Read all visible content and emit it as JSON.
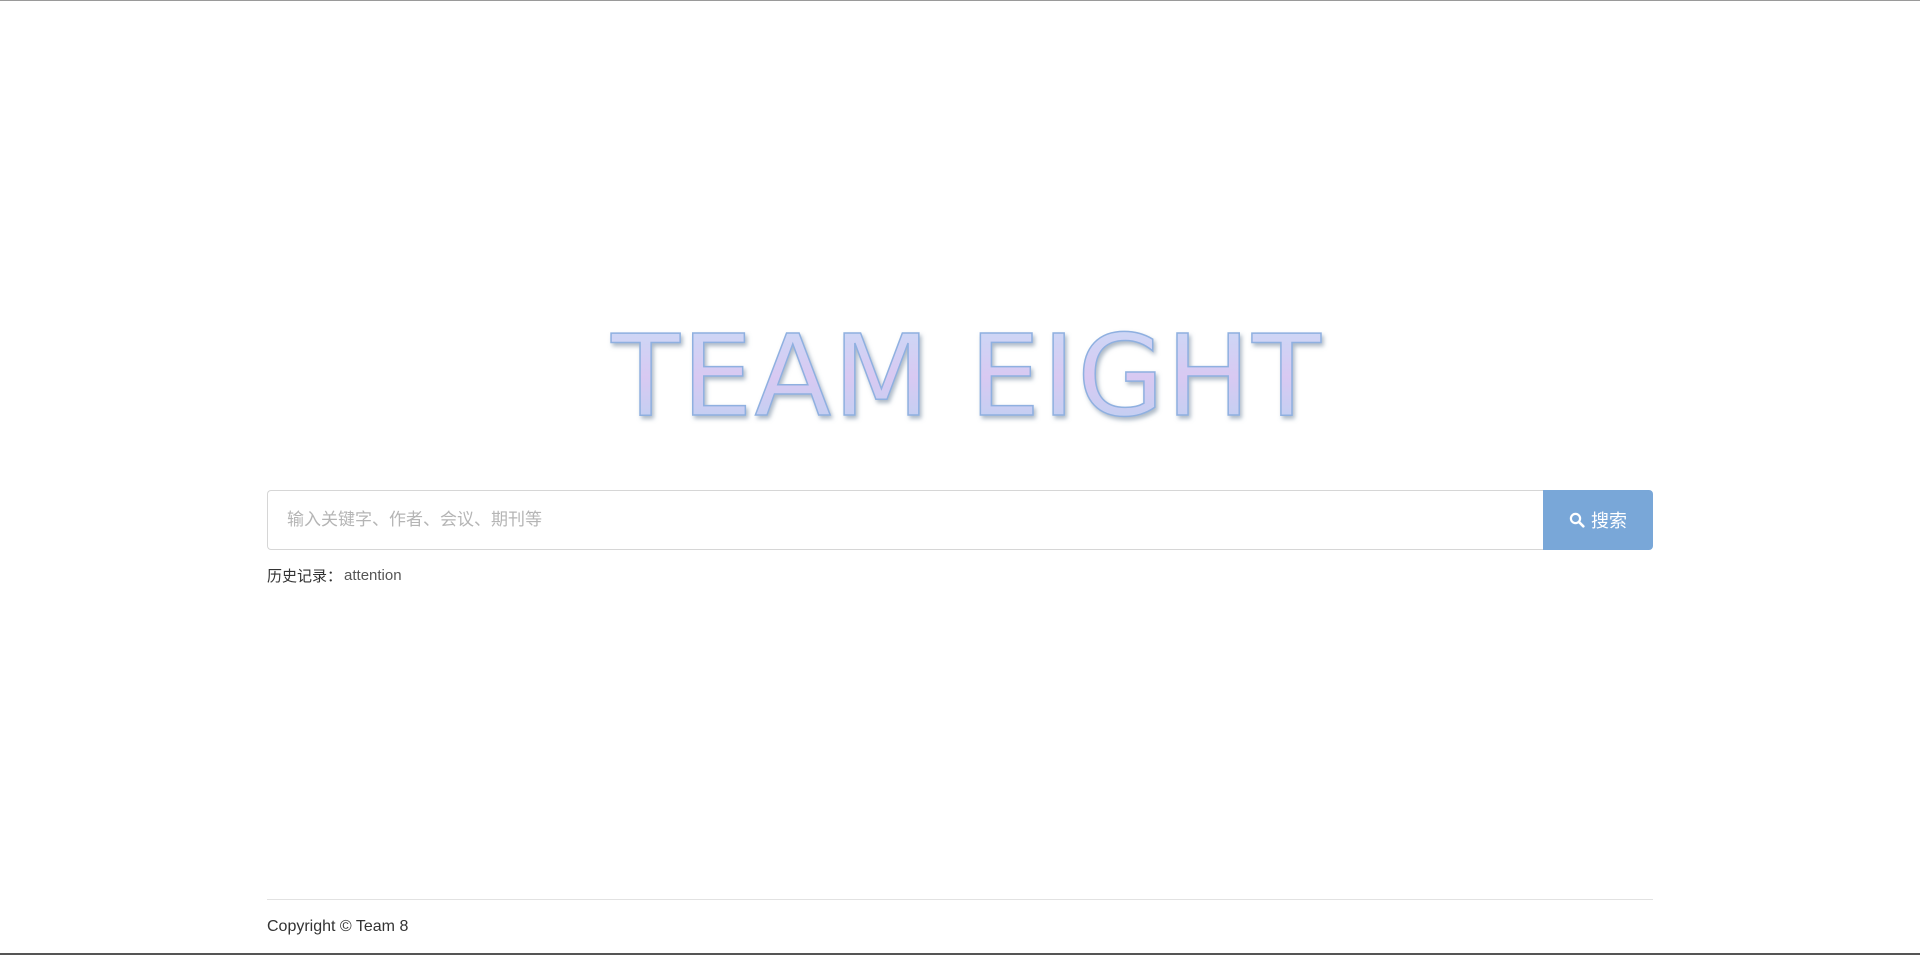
{
  "logo": {
    "text": "TEAM EIGHT",
    "fill_top": "#c9dcf7",
    "fill_mid": "#d8c9f2",
    "fill_bottom": "#b9d3f2",
    "stroke": "#8fb0e0"
  },
  "search": {
    "placeholder": "输入关键字、作者、会议、期刊等",
    "value": "",
    "button_label": "搜索",
    "button_icon": "search-icon",
    "button_color": "#79a7d8"
  },
  "history": {
    "label": "历史记录：",
    "items": [
      "attention"
    ]
  },
  "footer": {
    "copyright": "Copyright © Team 8"
  }
}
